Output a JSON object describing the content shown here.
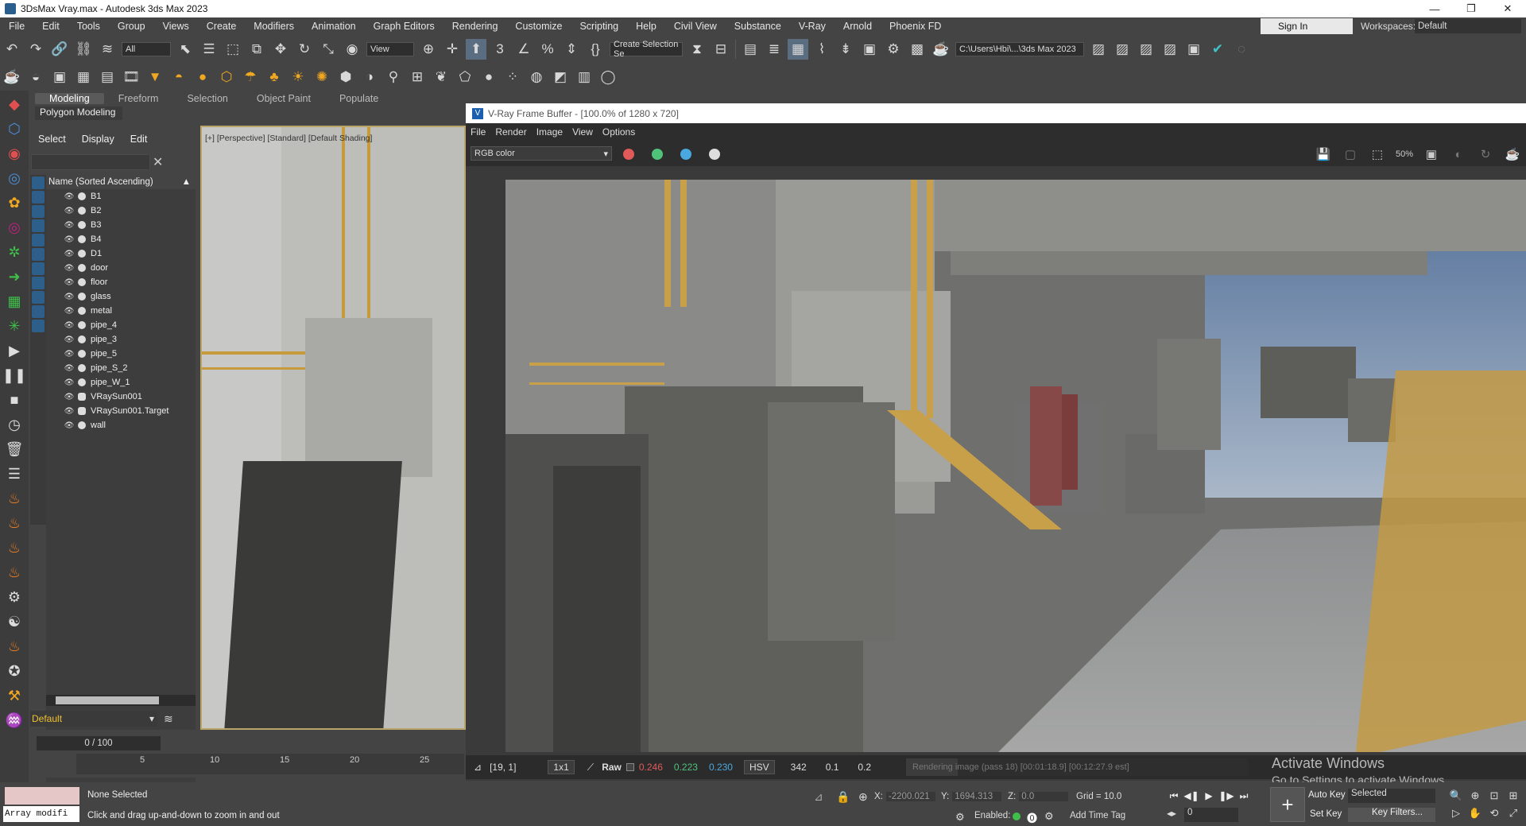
{
  "window": {
    "title": "3DsMax Vray.max - Autodesk 3ds Max 2023",
    "controls": [
      "—",
      "❐",
      "✕"
    ]
  },
  "menubar": {
    "items": [
      "File",
      "Edit",
      "Tools",
      "Group",
      "Views",
      "Create",
      "Modifiers",
      "Animation",
      "Graph Editors",
      "Rendering",
      "Customize",
      "Scripting",
      "Help",
      "Civil View",
      "Substance",
      "V-Ray",
      "Arnold",
      "Phoenix FD"
    ],
    "sign_in": "Sign In",
    "workspaces_label": "Workspaces:",
    "workspace_value": "Default"
  },
  "toolbar": {
    "filter_value": "All",
    "view_value": "View",
    "selection_set": "Create Selection Se",
    "project_path": "C:\\Users\\Hbi\\...\\3ds Max 2023"
  },
  "ribbon": {
    "tabs": [
      "Modeling",
      "Freeform",
      "Selection",
      "Object Paint",
      "Populate"
    ],
    "panel": "Polygon Modeling"
  },
  "explorer": {
    "tabs": [
      "Select",
      "Display",
      "Edit"
    ],
    "column_header": "Name (Sorted Ascending)",
    "objects": [
      "B1",
      "B2",
      "B3",
      "B4",
      "D1",
      "door",
      "floor",
      "glass",
      "metal",
      "pipe_4",
      "pipe_3",
      "pipe_5",
      "pipe_S_2",
      "pipe_W_1",
      "VRaySun001",
      "VRaySun001.Target",
      "wall"
    ],
    "layer": "Default"
  },
  "viewport": {
    "label": "[+] [Perspective] [Standard] [Default Shading]"
  },
  "timeline": {
    "slider": "0 / 100",
    "ticks": [
      "5",
      "10",
      "15",
      "20",
      "25"
    ]
  },
  "vfb": {
    "title": "V-Ray Frame Buffer - [100.0% of 1280 x 720]",
    "menus": [
      "File",
      "Render",
      "Image",
      "View",
      "Options"
    ],
    "channel": "RGB color",
    "zoom_tool": "50%",
    "status": {
      "coords": "[19, 1]",
      "ratio": "1x1",
      "mode": "Raw",
      "r": "0.246",
      "g": "0.223",
      "b": "0.230",
      "colorspace": "HSV",
      "h": "342",
      "s": "0.1",
      "v": "0.2",
      "progress_text": "Rendering image (pass 18) [00:01:18.9] [00:12:27.9 est]",
      "progress_fraction": 0.15
    },
    "colors": {
      "red": "#e05a5a",
      "green": "#4fc37a",
      "blue": "#4aa8e0"
    }
  },
  "activation": {
    "title": "Activate Windows",
    "subtitle": "Go to Settings to activate Windows."
  },
  "statusbar": {
    "maxscript": "Array modifi",
    "selection": "None Selected",
    "hint": "Click and drag up-and-down to zoom in and out",
    "x_label": "X:",
    "x": "-2200.021",
    "y_label": "Y:",
    "y": "1694.313",
    "z_label": "Z:",
    "z": "0.0",
    "grid": "Grid = 10.0",
    "enabled": "Enabled:",
    "add_time_tag": "Add Time Tag",
    "frame": "0",
    "auto_key": "Auto Key",
    "set_key": "Set Key",
    "key_mode": "Selected",
    "key_filters": "Key Filters..."
  }
}
